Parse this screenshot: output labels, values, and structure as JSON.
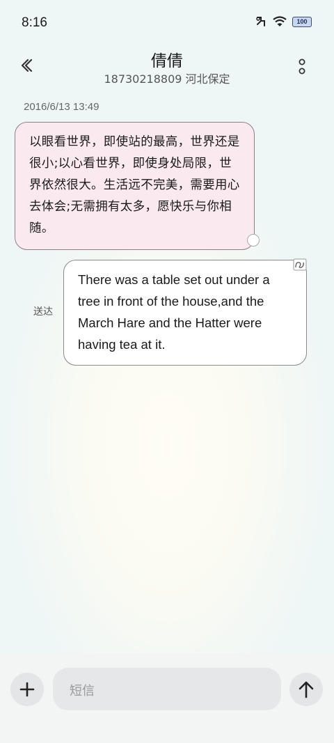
{
  "status_bar": {
    "time": "8:16",
    "battery": "100"
  },
  "header": {
    "title": "倩倩",
    "subtitle": "18730218809 河北保定"
  },
  "conversation": {
    "timestamp": "2016/6/13 13:49",
    "incoming_message": "以眼看世界，即使站的最高，世界还是很小;以心看世界，即使身处局限，世界依然很大。生活远不完美，需要用心去体会;无需拥有太多，愿快乐与你相随。",
    "outgoing_message": "There was a table set out under a tree in front of the house,and the March Hare and the Hatter were having tea at it.",
    "outgoing_status": "送达"
  },
  "composer": {
    "placeholder": "短信"
  }
}
